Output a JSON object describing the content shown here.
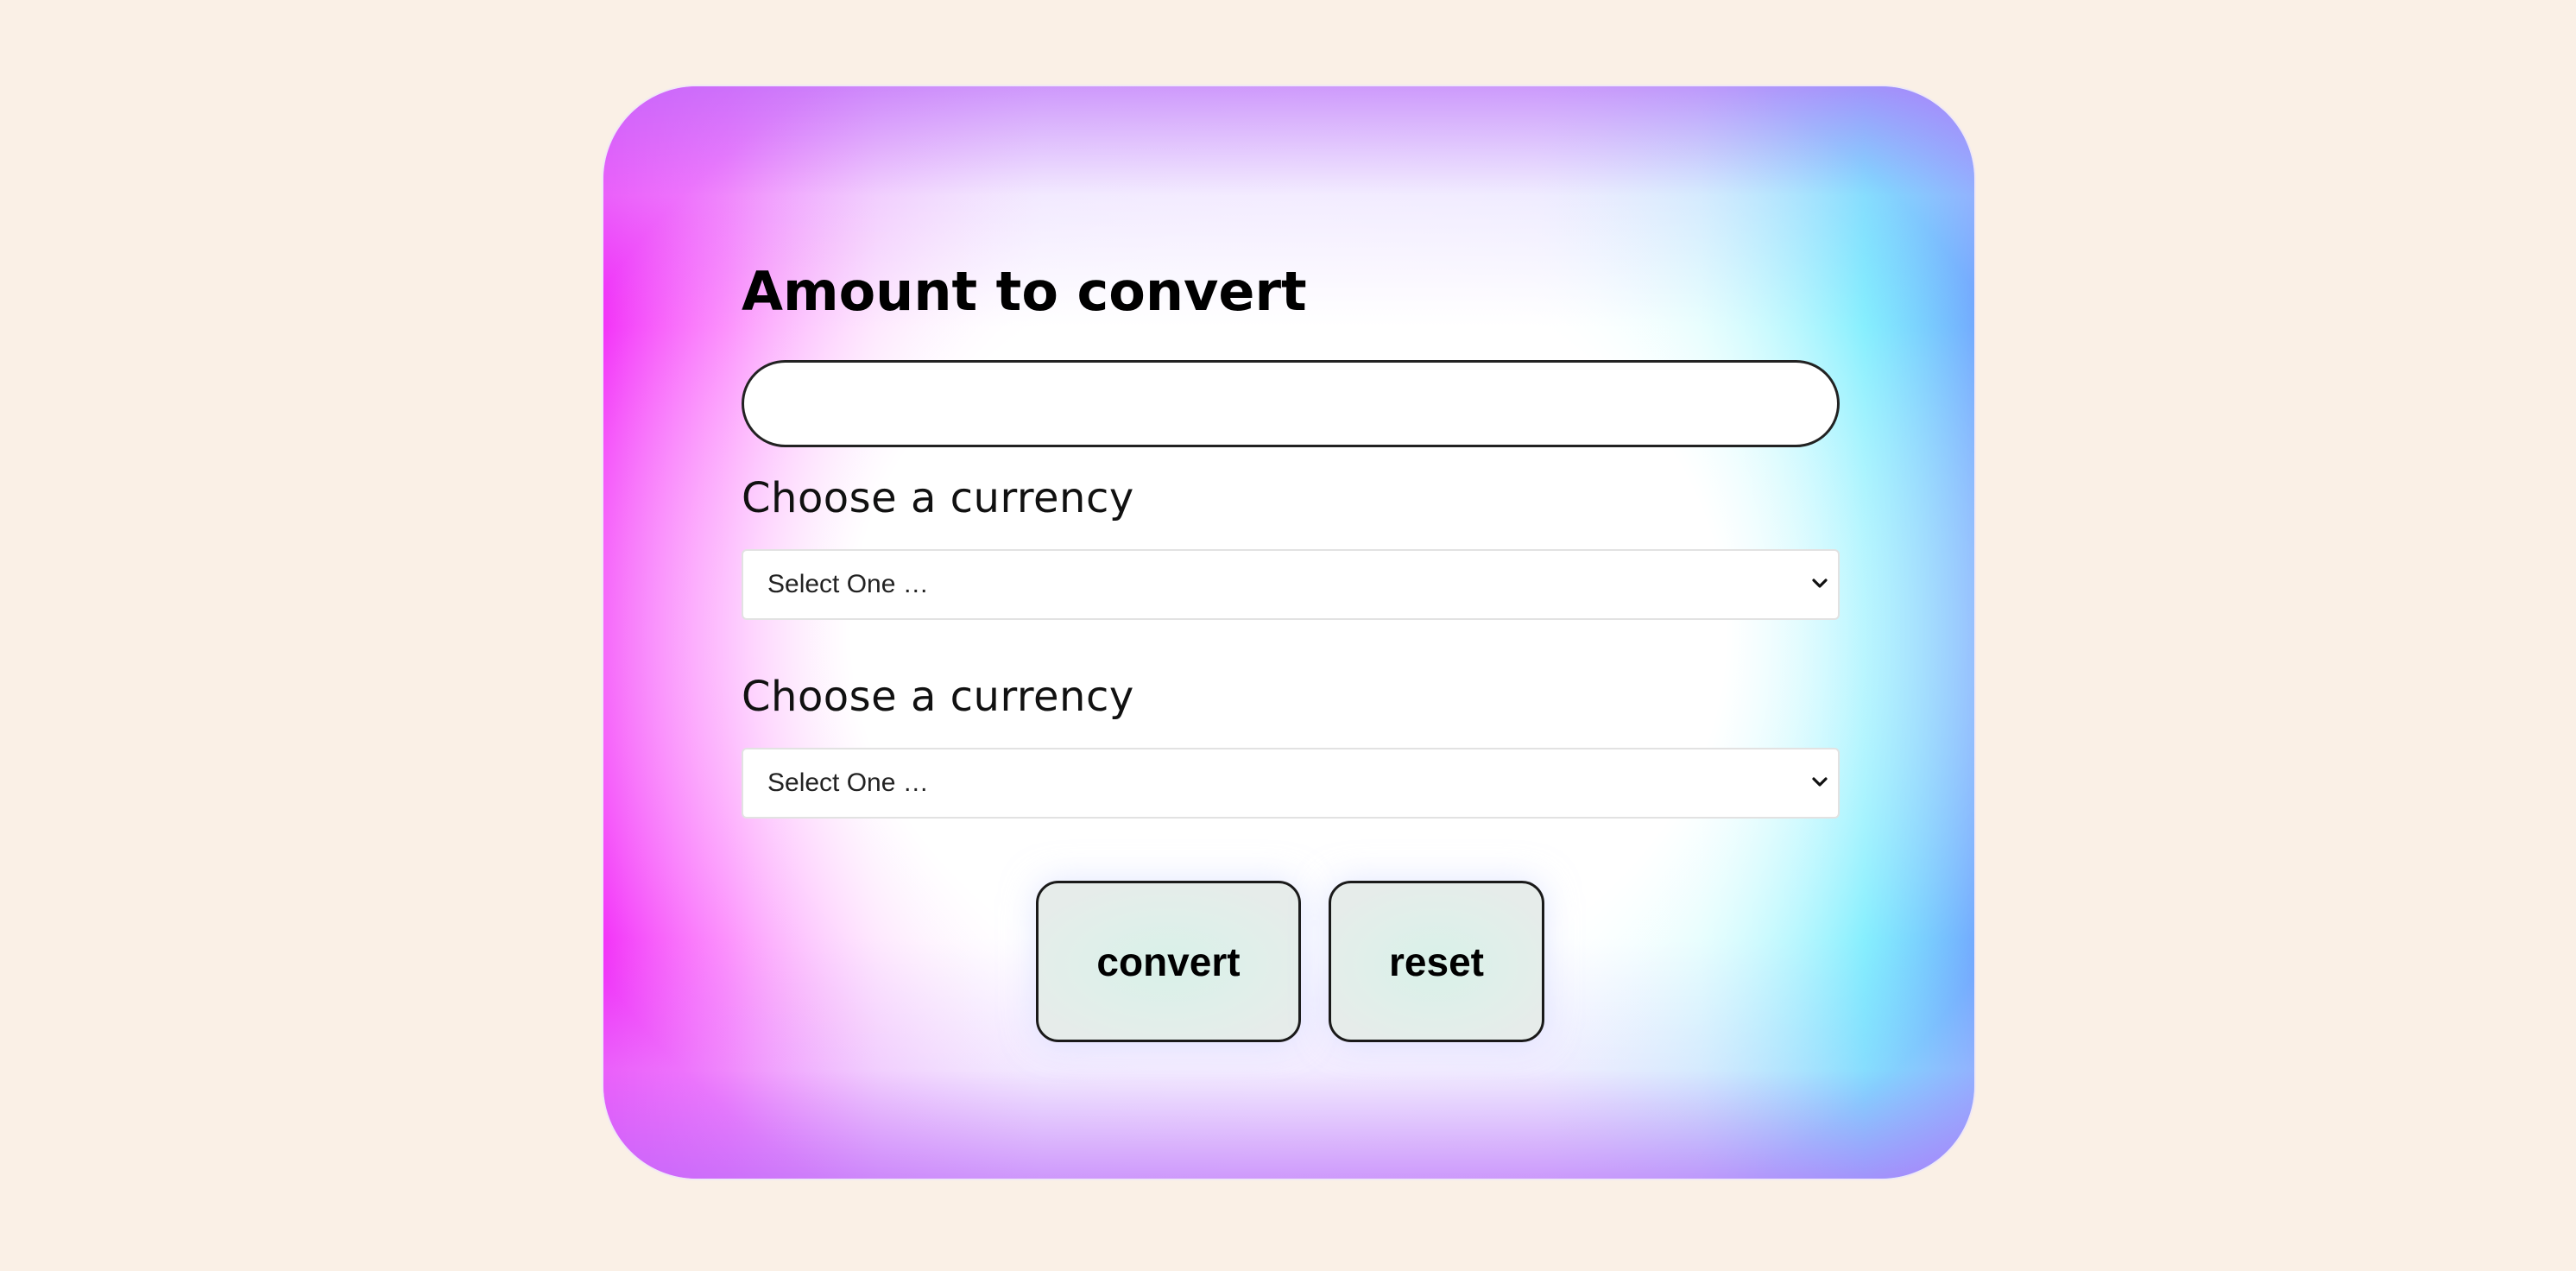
{
  "form": {
    "title": "Amount to convert",
    "amount_value": "",
    "amount_placeholder": "",
    "from_currency": {
      "label": "Choose a currency",
      "selected": "Select One …"
    },
    "to_currency": {
      "label": "Choose a currency",
      "selected": "Select One …"
    },
    "convert_label": "convert",
    "reset_label": "reset"
  },
  "colors": {
    "page_background": "#faf0e6",
    "gradient_left": "#f227f8",
    "gradient_right": "#4ce7fe",
    "gradient_top_bottom": "#be78fa",
    "button_background": "#e1efea"
  },
  "icons": {
    "select_arrow": "chevron-down-icon"
  }
}
